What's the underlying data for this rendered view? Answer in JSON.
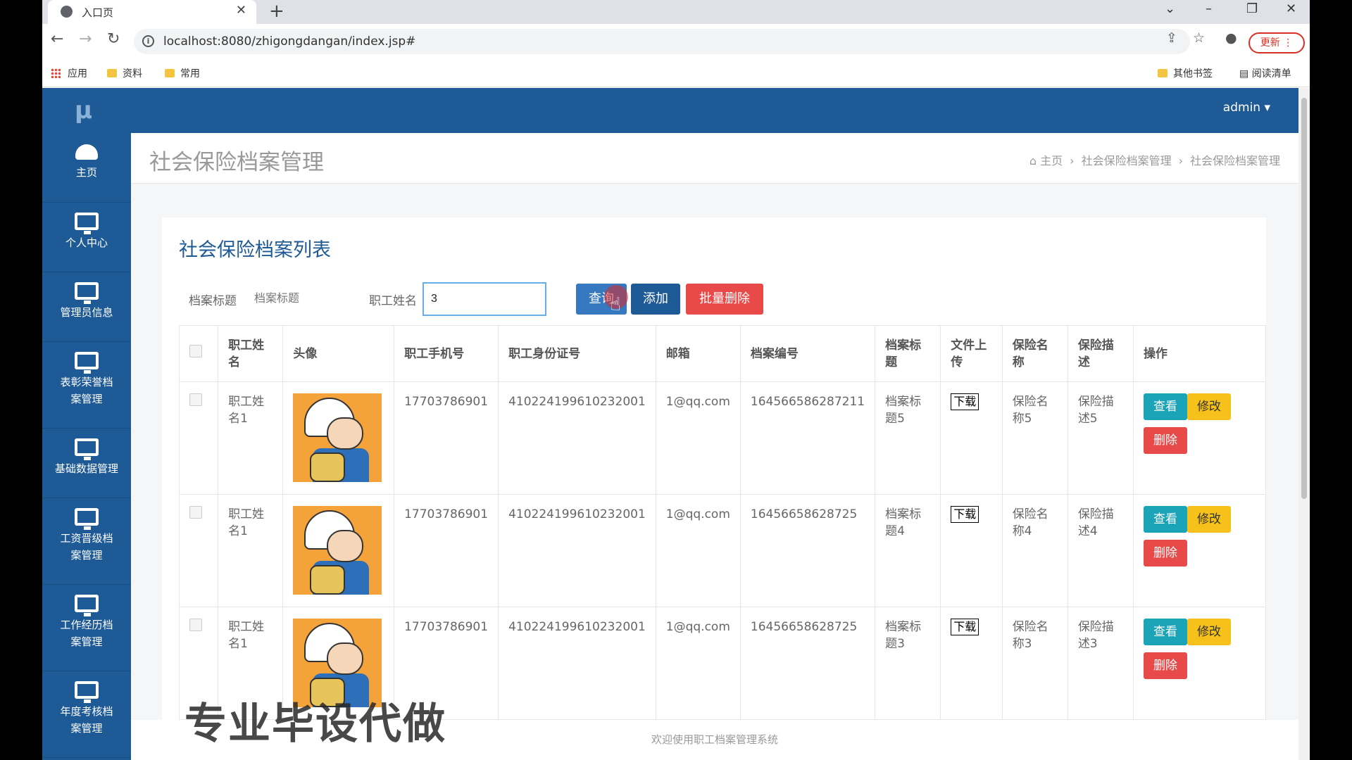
{
  "browser": {
    "tab_title": "入口页",
    "url": "localhost:8080/zhigongdangan/index.jsp#",
    "update_label": "更新",
    "bookmarks": [
      "应用",
      "资料",
      "常用"
    ],
    "bookmarks_right": [
      "其他书签",
      "阅读清单"
    ]
  },
  "app": {
    "logo": "μ",
    "user": "admin ▾",
    "sidebar": [
      {
        "label": "主页",
        "icon": "dashboard-icon"
      },
      {
        "label": "个人中心",
        "icon": "monitor-icon"
      },
      {
        "label": "管理员信息",
        "icon": "monitor-icon"
      },
      {
        "label": "表彰荣誉档案管理",
        "icon": "monitor-icon"
      },
      {
        "label": "基础数据管理",
        "icon": "monitor-icon"
      },
      {
        "label": "工资晋级档案管理",
        "icon": "monitor-icon"
      },
      {
        "label": "工作经历档案管理",
        "icon": "monitor-icon"
      },
      {
        "label": "年度考核档案管理",
        "icon": "monitor-icon"
      }
    ],
    "page_title": "社会保险档案管理",
    "breadcrumb": [
      "主页",
      "社会保险档案管理",
      "社会保险档案管理"
    ],
    "list_title": "社会保险档案列表",
    "search": {
      "title_label": "档案标题",
      "title_placeholder": "档案标题",
      "name_label": "职工姓名",
      "name_value": "3",
      "query_btn": "查询",
      "add_btn": "添加",
      "batch_delete_btn": "批量删除"
    },
    "table": {
      "headers": [
        "职工姓名",
        "头像",
        "职工手机号",
        "职工身份证号",
        "邮箱",
        "档案编号",
        "档案标题",
        "文件上传",
        "保险名称",
        "保险描述",
        "操作"
      ],
      "rows": [
        {
          "name": "职工姓名1",
          "phone": "17703786901",
          "idcard": "410224199610232001",
          "email": "1@qq.com",
          "code": "164566586287211",
          "title": "档案标题5",
          "file": "下载",
          "ins_name": "保险名称5",
          "ins_desc": "保险描述5"
        },
        {
          "name": "职工姓名1",
          "phone": "17703786901",
          "idcard": "410224199610232001",
          "email": "1@qq.com",
          "code": "16456658628725",
          "title": "档案标题4",
          "file": "下载",
          "ins_name": "保险名称4",
          "ins_desc": "保险描述4"
        },
        {
          "name": "职工姓名1",
          "phone": "17703786901",
          "idcard": "410224199610232001",
          "email": "1@qq.com",
          "code": "16456658628725",
          "title": "档案标题3",
          "file": "下载",
          "ins_name": "保险名称3",
          "ins_desc": "保险描述3"
        }
      ],
      "op_view": "查看",
      "op_edit": "修改",
      "op_delete": "删除"
    },
    "footer": "欢迎使用职工档案管理系统",
    "watermark": "专业毕设代做"
  },
  "colors": {
    "brand": "#1e5a96",
    "view": "#1ba3b8",
    "edit": "#f5c11a",
    "delete": "#e84a4a",
    "query": "#3779c0"
  }
}
